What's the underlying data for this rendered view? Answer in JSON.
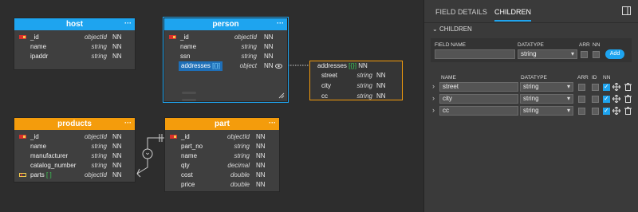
{
  "tables": {
    "host": {
      "title": "host",
      "menu": "···",
      "fields": [
        {
          "name": "_id",
          "type": "objectId",
          "nn": "NN"
        },
        {
          "name": "name",
          "type": "string",
          "nn": "NN"
        },
        {
          "name": "ipaddr",
          "type": "string",
          "nn": "NN"
        }
      ]
    },
    "person": {
      "title": "person",
      "menu": "···",
      "fields": [
        {
          "name": "_id",
          "type": "objectId",
          "nn": "NN"
        },
        {
          "name": "name",
          "type": "string",
          "nn": "NN"
        },
        {
          "name": "ssn",
          "type": "string",
          "nn": "NN"
        },
        {
          "name": "addresses",
          "suffix": "[{}]",
          "type": "object",
          "nn": "NN"
        }
      ]
    },
    "products": {
      "title": "products",
      "menu": "···",
      "fields": [
        {
          "name": "_id",
          "type": "objectId",
          "nn": "NN"
        },
        {
          "name": "name",
          "type": "string",
          "nn": "NN"
        },
        {
          "name": "manufacturer",
          "type": "string",
          "nn": "NN"
        },
        {
          "name": "catalog_number",
          "type": "string",
          "nn": "NN"
        },
        {
          "name": "parts",
          "suffix": "[ ]",
          "type": "objectId",
          "nn": "NN"
        }
      ]
    },
    "part": {
      "title": "part",
      "menu": "···",
      "fields": [
        {
          "name": "_id",
          "type": "objectId",
          "nn": "NN"
        },
        {
          "name": "part_no",
          "type": "string",
          "nn": "NN"
        },
        {
          "name": "name",
          "type": "string",
          "nn": "NN"
        },
        {
          "name": "qty",
          "type": "decimal",
          "nn": "NN"
        },
        {
          "name": "cost",
          "type": "double",
          "nn": "NN"
        },
        {
          "name": "price",
          "type": "double",
          "nn": "NN"
        }
      ]
    },
    "addresses": {
      "title": "addresses",
      "suffix": "[{}]",
      "nn": "NN",
      "fields": [
        {
          "name": "street",
          "type": "string",
          "nn": "NN"
        },
        {
          "name": "city",
          "type": "string",
          "nn": "NN"
        },
        {
          "name": "cc",
          "type": "string",
          "nn": "NN"
        }
      ]
    }
  },
  "panel": {
    "tabs": [
      "FIELD DETAILS",
      "CHILDREN"
    ],
    "active_tab": "CHILDREN",
    "section": "CHILDREN",
    "new_field": {
      "name_label": "FIELD NAME",
      "type_label": "DATATYPE",
      "arr_label": "ARR",
      "nn_label": "NN",
      "name_value": "",
      "type_value": "string",
      "add_label": "Add"
    },
    "list_headers": {
      "name": "NAME",
      "type": "DATATYPE",
      "arr": "ARR",
      "id": "ID",
      "nn": "NN"
    },
    "children": [
      {
        "name": "street",
        "type": "string",
        "arr": false,
        "id": false,
        "nn": true
      },
      {
        "name": "city",
        "type": "string",
        "arr": false,
        "id": false,
        "nn": true
      },
      {
        "name": "cc",
        "type": "string",
        "arr": false,
        "id": false,
        "nn": true
      }
    ]
  },
  "relation": {
    "symbol": "⌄"
  },
  "colors": {
    "blue": "#1ea4ef",
    "orange": "#f49c0c",
    "panel": "#3a3a3a",
    "canvas": "#2d2d2d"
  }
}
